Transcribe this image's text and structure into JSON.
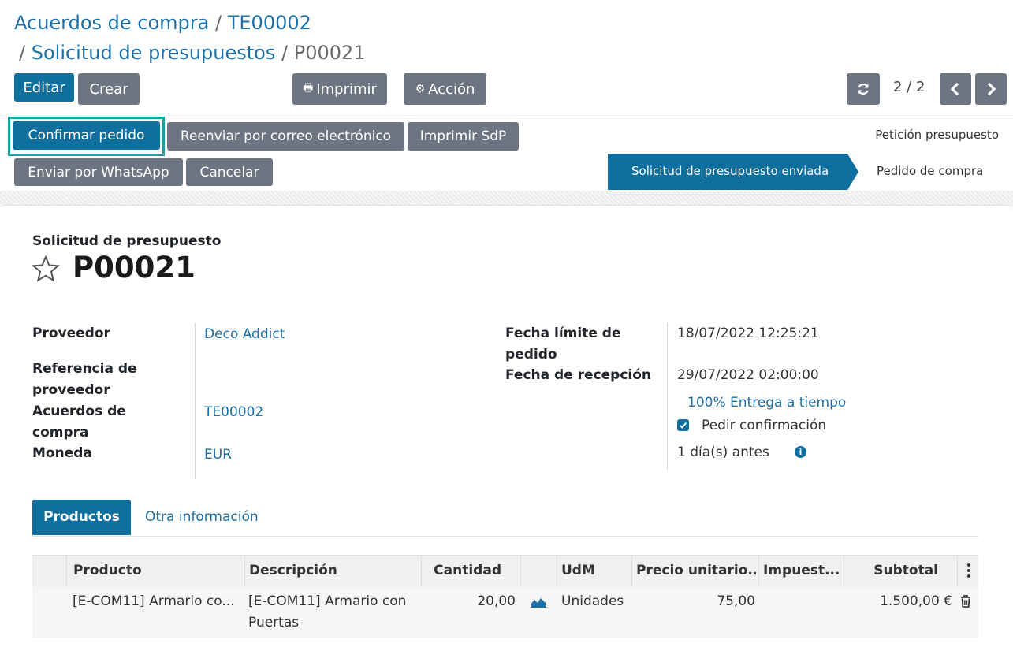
{
  "breadcrumb": {
    "item1": "Acuerdos de compra",
    "item2": "TE00002",
    "item3": "Solicitud de presupuestos",
    "current": "P00021",
    "separator": "/"
  },
  "toolbar": {
    "edit": "Editar",
    "create": "Crear",
    "print": "Imprimir",
    "action": "Acción",
    "pager": "2 / 2"
  },
  "actions": {
    "confirm": "Confirmar pedido",
    "resend": "Reenviar por correo electrónico",
    "print_rfq": "Imprimir SdP",
    "whatsapp": "Enviar por WhatsApp",
    "cancel": "Cancelar"
  },
  "statusbar": {
    "step1": "Petición presupuesto",
    "step2": "Solicitud de presupuesto enviada",
    "step3": "Pedido de compra"
  },
  "form": {
    "doc_type": "Solicitud de presupuesto",
    "name": "P00021",
    "left": {
      "vendor_label": "Proveedor",
      "vendor_value": "Deco Addict",
      "vendor_ref_label_1": "Referencia de",
      "vendor_ref_label_2": "proveedor",
      "agreement_label_1": "Acuerdos de",
      "agreement_label_2": "compra",
      "agreement_value": "TE00002",
      "currency_label": "Moneda",
      "currency_value": "EUR"
    },
    "right": {
      "deadline_label_1": "Fecha límite de",
      "deadline_label_2": "pedido",
      "deadline_value": "18/07/2022 12:25:21",
      "receipt_label": "Fecha de recepción",
      "receipt_value": "29/07/2022 02:00:00",
      "on_time": "100% Entrega a tiempo",
      "ask_confirm": "Pedir confirmación",
      "days_before": "1 día(s) antes"
    }
  },
  "tabs": {
    "products": "Productos",
    "other": "Otra información"
  },
  "table": {
    "headers": {
      "product": "Producto",
      "description": "Descripción",
      "quantity": "Cantidad",
      "uom": "UdM",
      "price": "Precio unitario...",
      "taxes": "Impuest...",
      "subtotal": "Subtotal"
    },
    "rows": [
      {
        "product": "[E-COM11] Armario co...",
        "description_1": "[E-COM11] Armario con",
        "description_2": "Puertas",
        "quantity": "20,00",
        "uom": "Unidades",
        "price": "75,00",
        "subtotal": "1.500,00 €"
      }
    ]
  },
  "colors": {
    "primary": "#0f6f9e",
    "secondary": "#6d7582",
    "link": "#1d6fa5",
    "highlight": "#17a2a0"
  }
}
